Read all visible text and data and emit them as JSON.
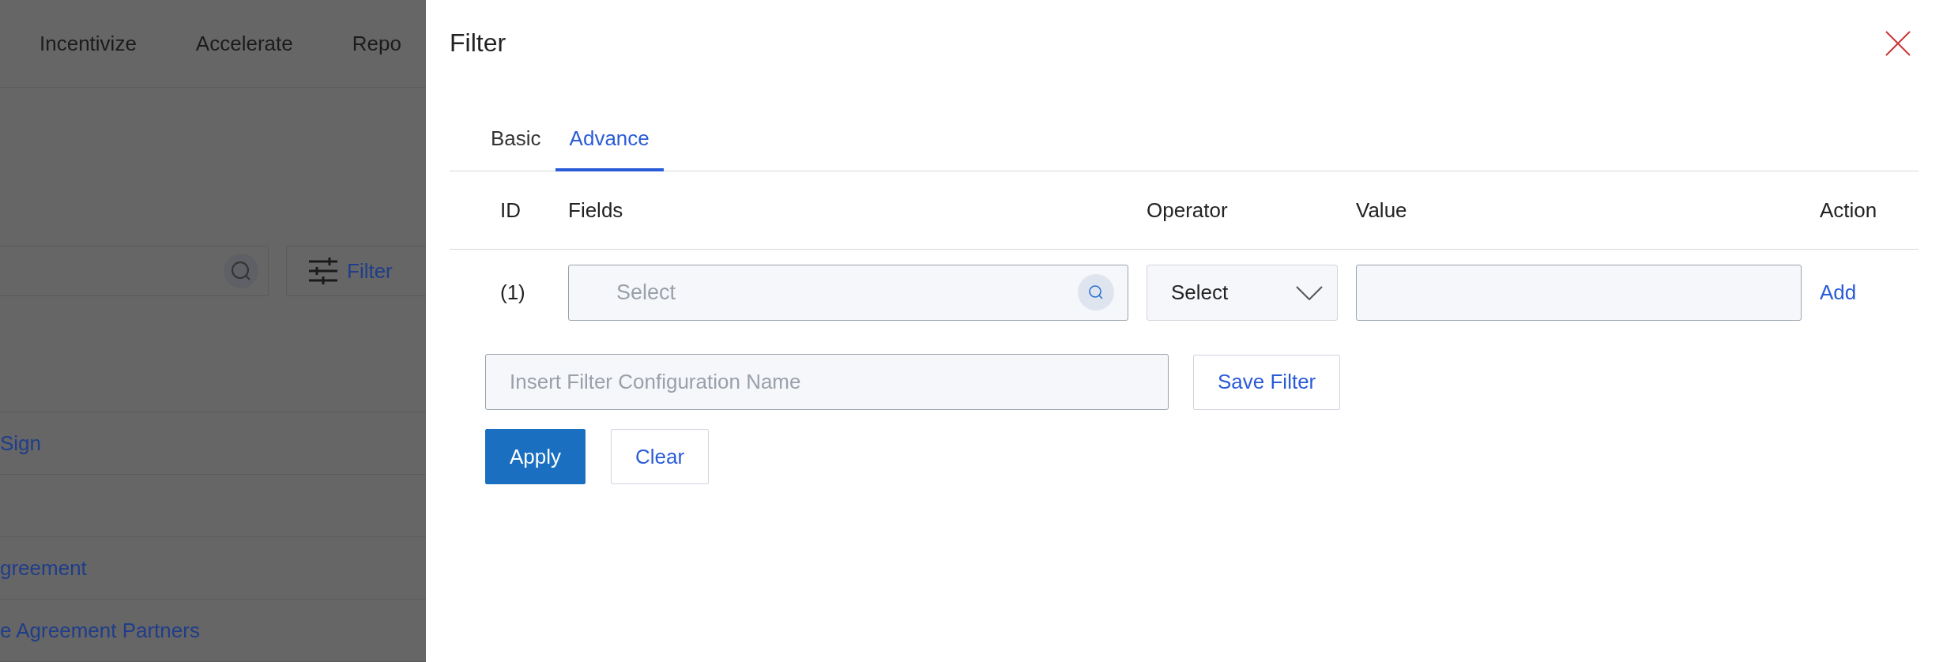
{
  "background": {
    "nav": [
      "Incentivize",
      "Accelerate",
      "Repo"
    ],
    "filter_button": {
      "label": "Filter"
    },
    "rows": [
      {
        "link": "Sign"
      },
      {},
      {
        "link": "greement"
      },
      {
        "link": "e Agreement Partners"
      }
    ]
  },
  "panel": {
    "title": "Filter",
    "tabs": [
      {
        "label": "Basic",
        "selected": false
      },
      {
        "label": "Advance",
        "selected": true
      }
    ],
    "columns": [
      "ID",
      "Fields",
      "Operator",
      "Value",
      "Action"
    ],
    "rows": [
      {
        "id": "(1)",
        "field_placeholder": "Select",
        "operator": "Select",
        "action": "Add"
      }
    ],
    "config_name": {
      "placeholder": "Insert Filter Configuration Name"
    },
    "save_button": "Save Filter",
    "apply_button": "Apply",
    "clear_button": "Clear"
  }
}
